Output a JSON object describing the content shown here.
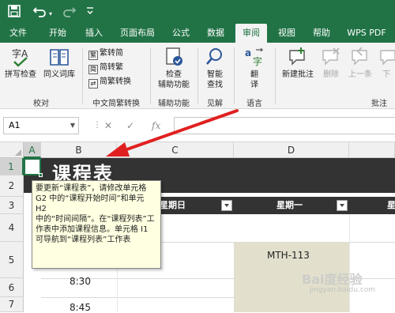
{
  "quick_access": {
    "save_icon": "save-icon",
    "undo_icon": "undo-icon",
    "redo_icon": "redo-icon",
    "customize_icon": "chevron-down-icon"
  },
  "tabs": [
    {
      "label": "文件"
    },
    {
      "label": "开始"
    },
    {
      "label": "插入"
    },
    {
      "label": "页面布局"
    },
    {
      "label": "公式"
    },
    {
      "label": "数据"
    },
    {
      "label": "审阅",
      "active": true
    },
    {
      "label": "视图"
    },
    {
      "label": "帮助"
    },
    {
      "label": "WPS PDF"
    }
  ],
  "ribbon": {
    "spell_check": "拼写检查",
    "thesaurus": "同义词库",
    "group_proofing": "校对",
    "to_simplified": "繁转简",
    "to_traditional": "简转繁",
    "convert": "简繁转换",
    "group_chinese": "中文简繁转换",
    "accessibility_line1": "检查",
    "accessibility_line2": "辅助功能",
    "group_accessibility": "辅助功能",
    "smart_lookup_line1": "智能",
    "smart_lookup_line2": "查找",
    "group_insights": "见解",
    "translate_line1": "翻",
    "translate_line2": "译",
    "group_language": "语言",
    "new_comment": "新建批注",
    "delete": "删除",
    "previous": "上一条",
    "next": "下",
    "group_comments": "批注"
  },
  "formula_bar": {
    "name_box": "A1",
    "cancel": "✕",
    "enter": "✓",
    "fx": "fx",
    "formula": ""
  },
  "grid": {
    "columns": [
      "A",
      "B",
      "C",
      "D"
    ],
    "rows": [
      "1",
      "2",
      "3",
      "4",
      "5",
      "6",
      "7"
    ],
    "title": "课程表",
    "header_day_sun": "星期日",
    "header_day_mon": "星期一",
    "header_next": "星",
    "cell_d5": "MTH-113",
    "cell_b6": "8:30",
    "cell_b7": "8:45"
  },
  "comment": {
    "lines": [
      "要更新“课程表”，请修改单元格",
      "G2 中的“课程开始时间”和单元",
      "H2",
      "中的“时间间隔”。在“课程列表”工",
      "作表中添加课程信息。单元格 I1",
      "可导航到“课程列表”工作表"
    ]
  },
  "watermark": {
    "text": "Bai度经验",
    "sub": "jingyan.baidu.com"
  },
  "colors": {
    "excel_green": "#217346",
    "arrow_red": "#e02020",
    "comment_bg": "#ffffe1",
    "dark_band": "#333333",
    "shade": "#e2e0cc"
  }
}
